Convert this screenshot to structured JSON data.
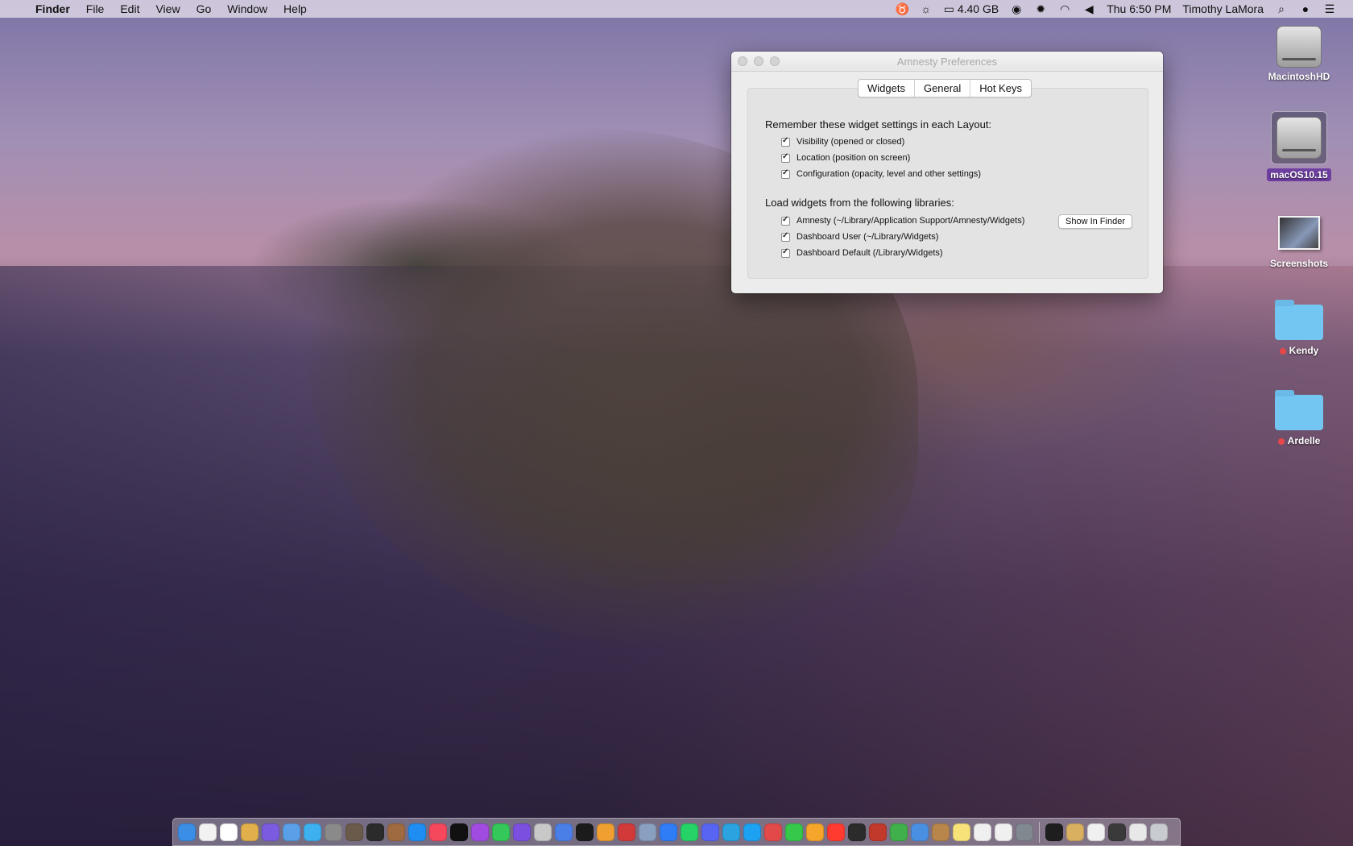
{
  "menubar": {
    "app": "Finder",
    "menus": [
      "File",
      "Edit",
      "View",
      "Go",
      "Window",
      "Help"
    ],
    "storage": "4.40 GB",
    "clock": "Thu 6:50 PM",
    "user": "Timothy LaMora"
  },
  "desktop": {
    "icons": [
      {
        "label": "MacintoshHD"
      },
      {
        "label": "macOS10.15"
      },
      {
        "label": "Screenshots"
      },
      {
        "label": "Kendy"
      },
      {
        "label": "Ardelle"
      }
    ]
  },
  "window": {
    "title": "Amnesty Preferences",
    "tabs": [
      "Widgets",
      "General",
      "Hot Keys"
    ],
    "section1": {
      "title": "Remember these widget settings in each Layout:",
      "options": [
        "Visibility (opened or closed)",
        "Location (position on screen)",
        "Configuration (opacity, level and other settings)"
      ]
    },
    "section2": {
      "title": "Load widgets from the following libraries:",
      "options": [
        "Amnesty (~/Library/Application Support/Amnesty/Widgets)",
        "Dashboard User (~/Library/Widgets)",
        "Dashboard Default (/Library/Widgets)"
      ],
      "button": "Show In Finder"
    }
  },
  "dock": {
    "apps": [
      "finder",
      "clock",
      "calendar",
      "notifications",
      "siri",
      "launchpad",
      "safari",
      "rocket",
      "photos-landscape",
      "moon",
      "rocket-ball",
      "app-store",
      "music",
      "tv",
      "podcasts",
      "find-my",
      "spark",
      "preview",
      "chrome",
      "quicktime",
      "photos",
      "mosaic",
      "system-info",
      "messenger",
      "whatsapp",
      "discord",
      "telegram",
      "twitter",
      "weibo",
      "messages",
      "home",
      "news",
      "claquette",
      "record",
      "maps",
      "preview-doc",
      "notes-brown",
      "notes",
      "textedit",
      "pages",
      "screen-sharing"
    ],
    "right_apps": [
      "terminal",
      "brushes",
      "downloads",
      "screen",
      "keyboard",
      "trash"
    ]
  },
  "colors": {
    "accent_label": "#6e3fa1",
    "folder": "#74c6f2"
  }
}
